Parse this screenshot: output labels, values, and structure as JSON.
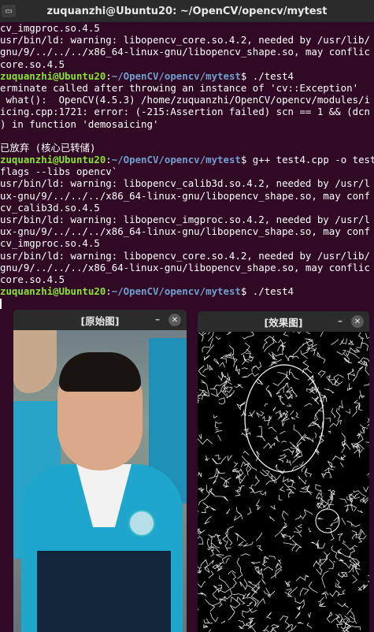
{
  "terminal": {
    "title": "zuquanzhi@Ubuntu20: ~/OpenCV/opencv/mytest",
    "lines": [
      {
        "type": "text",
        "text": "cv_imgproc.so.4.5"
      },
      {
        "type": "text",
        "text": "usr/bin/ld: warning: libopencv_core.so.4.2, needed by /usr/lib/"
      },
      {
        "type": "text",
        "text": "gnu/9/../../../x86_64-linux-gnu/libopencv_shape.so, may conflic"
      },
      {
        "type": "text",
        "text": "core.so.4.5"
      },
      {
        "type": "prompt",
        "user": "zuquanzhi@Ubuntu20",
        "path": "~/OpenCV/opencv/mytest",
        "cmd": "./test4"
      },
      {
        "type": "text",
        "text": "erminate called after throwing an instance of 'cv::Exception'"
      },
      {
        "type": "text",
        "text": " what():  OpenCV(4.5.3) /home/zuquanzhi/OpenCV/opencv/modules/i"
      },
      {
        "type": "text",
        "text": "icing.cpp:1721: error: (-215:Assertion failed) scn == 1 && (dcn"
      },
      {
        "type": "text",
        "text": ") in function 'demosaicing'"
      },
      {
        "type": "text",
        "text": ""
      },
      {
        "type": "text",
        "text": "已放弃 (核心已转储)"
      },
      {
        "type": "prompt",
        "user": "zuquanzhi@Ubuntu20",
        "path": "~/OpenCV/opencv/mytest",
        "cmd": "g++ test4.cpp -o test"
      },
      {
        "type": "text",
        "text": "flags --libs opencv`"
      },
      {
        "type": "text",
        "text": "usr/bin/ld: warning: libopencv_calib3d.so.4.2, needed by /usr/l"
      },
      {
        "type": "text",
        "text": "ux-gnu/9/../../../x86_64-linux-gnu/libopencv_shape.so, may conf"
      },
      {
        "type": "text",
        "text": "cv_calib3d.so.4.5"
      },
      {
        "type": "text",
        "text": "usr/bin/ld: warning: libopencv_imgproc.so.4.2, needed by /usr/l"
      },
      {
        "type": "text",
        "text": "ux-gnu/9/../../../x86_64-linux-gnu/libopencv_shape.so, may conf"
      },
      {
        "type": "text",
        "text": "cv_imgproc.so.4.5"
      },
      {
        "type": "text",
        "text": "usr/bin/ld: warning: libopencv_core.so.4.2, needed by /usr/lib/"
      },
      {
        "type": "text",
        "text": "gnu/9/../../../x86_64-linux-gnu/libopencv_shape.so, may conflic"
      },
      {
        "type": "text",
        "text": "core.so.4.5"
      },
      {
        "type": "prompt",
        "user": "zuquanzhi@Ubuntu20",
        "path": "~/OpenCV/opencv/mytest",
        "cmd": "./test4"
      }
    ],
    "colors": {
      "background": "#300a24",
      "user": "#8ae234",
      "path": "#729fcf",
      "text": "#ffffff"
    }
  },
  "windows": {
    "original": {
      "title": "[原始图]",
      "min": "–",
      "close": "✕"
    },
    "effect": {
      "title": "[效果图]",
      "min": "–",
      "close": "✕"
    }
  }
}
